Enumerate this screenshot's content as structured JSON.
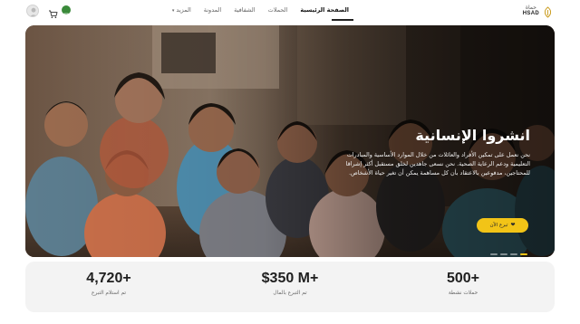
{
  "header": {
    "logo_ar": "حماة",
    "logo_en": "HSAD",
    "nav": [
      {
        "label": "الصفحة الرئيسية",
        "active": true
      },
      {
        "label": "الحملات",
        "active": false
      },
      {
        "label": "الشفافية",
        "active": false
      },
      {
        "label": "المدونة",
        "active": false
      },
      {
        "label": "المزيد",
        "active": false,
        "dropdown": true
      }
    ],
    "icons": {
      "user": "user-avatar-icon",
      "cart": "cart-icon",
      "language": "language-flag-icon"
    }
  },
  "hero": {
    "title": "انشروا الإنسانية",
    "description": "نحن نعمل على تمكين الأفراد والعائلات من خلال الموارد الأساسية والمبادرات التعليمية ودعم الرعاية الصحية. نحن نسعى جاهدين لخلق مستقبل أكثر إشراقا للمحتاجين، مدفوعين بالاعتقاد بأن كل مساهمة يمكن أن تغير حياة الأشخاص.",
    "donate_label": "تبرع الآن",
    "slides_total": 4,
    "slide_active": 1,
    "accent_color": "#f2c417"
  },
  "stats": [
    {
      "value": "500+",
      "label": "حملات نشطة"
    },
    {
      "value": "$350 M+",
      "label": "تم التبرع بالمال"
    },
    {
      "value": "4,720+",
      "label": "تم استلام التبرع"
    }
  ]
}
